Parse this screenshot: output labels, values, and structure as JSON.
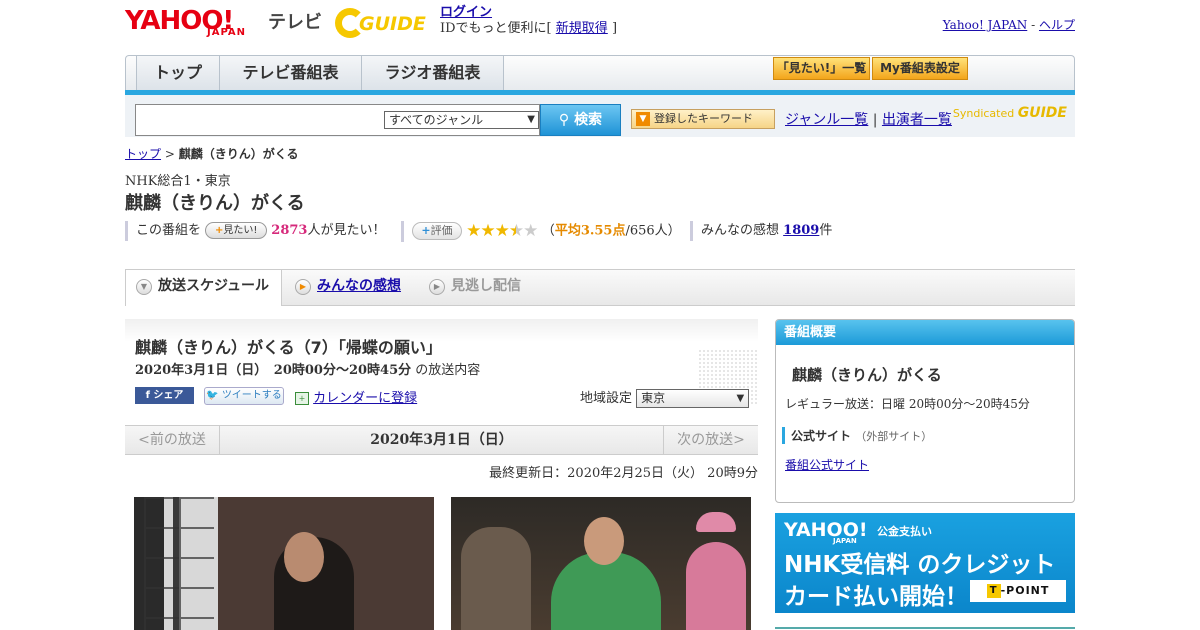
{
  "header": {
    "yahoo_logo": "YAHOO!",
    "japan_logo": "JAPAN",
    "tv_label": "テレビ",
    "gguide_logo": "GUIDE",
    "login_link": "ログイン",
    "login_text": "IDでもっと便利に[",
    "signup_link": "新規取得",
    "signup_close": "]",
    "yahoo_japan_link": "Yahoo! JAPAN",
    "separator": "-",
    "help_link": "ヘルプ"
  },
  "nav": {
    "tabs": [
      "トップ",
      "テレビ番組表",
      "ラジオ番組表"
    ],
    "mitai_list_btn": "「見たい!」一覧",
    "my_schedule_btn": "My番組表設定"
  },
  "search": {
    "input_value": "",
    "genre_selected": "すべてのジャンル",
    "search_btn": "検索",
    "keyword_btn": "登録したキーワード",
    "genre_list_link": "ジャンル一覧",
    "link_separator": "|",
    "cast_list_link": "出演者一覧",
    "syndicated_label": "Syndicated",
    "syndicated_logo": "GUIDE"
  },
  "program": {
    "breadcrumb_top": "トップ",
    "breadcrumb_sep": ">",
    "breadcrumb_current": "麒麟（きりん）がくる",
    "channel": "NHK総合1・東京",
    "title": "麒麟（きりん）がくる",
    "mitai_prefix": "この番組を",
    "mitai_btn": "見たい!",
    "mitai_count": "2873",
    "mitai_suffix": "人が見たい！",
    "hyoka_btn": "評価",
    "rating_stars": 3.5,
    "rating_open": "（",
    "rating_avg": "平均3.55点",
    "rating_count": "/656人）",
    "impression_label": "みんなの感想",
    "impression_count": "1809",
    "impression_suffix": "件"
  },
  "tabs": {
    "schedule": "放送スケジュール",
    "impressions": "みんなの感想",
    "vod": "見逃し配信"
  },
  "episode": {
    "title": "麒麟（きりん）がくる（7）「帰蝶の願い」",
    "datetime": "2020年3月1日（日）　20時00分～20時45分",
    "datetime_suffix": "の放送内容",
    "fb_share": "シェア",
    "tweet": "ツイートする",
    "calendar_link": "カレンダーに登録",
    "region_label": "地域設定",
    "region_selected": "東京",
    "prev_btn": "<前の放送",
    "current_date": "2020年3月1日（日）",
    "next_btn": "次の放送>",
    "updated": "最終更新日：2020年2月25日（火） 20時9分"
  },
  "overview": {
    "header": "番組概要",
    "title": "麒麟（きりん）がくる",
    "regular": "レギュラー放送：日曜 20時00分～20時45分",
    "official_label": "公式サイト",
    "official_note": "（外部サイト）",
    "official_link": "番組公式サイト"
  },
  "banner": {
    "yahoo": "YAHOO!",
    "japan": "JAPAN",
    "pay": "公金支払い",
    "line1": "NHK受信料 のクレジット",
    "line2": "カード払い開始！",
    "tpoint_t": "T",
    "tpoint": "-POINT"
  },
  "colors": {
    "accent_blue": "#2aa7e0",
    "yahoo_red": "#e60012",
    "gguide_yellow": "#f6c800",
    "link": "#1a0dab",
    "pink_count": "#d6297b",
    "rating_orange": "#e58a00"
  },
  "icons": {
    "search": "search-icon",
    "plus": "plus-icon",
    "star": "star-icon",
    "calendar": "calendar-icon",
    "facebook": "facebook-icon",
    "twitter": "twitter-icon",
    "tab_arrow": "arrow-down-icon"
  }
}
